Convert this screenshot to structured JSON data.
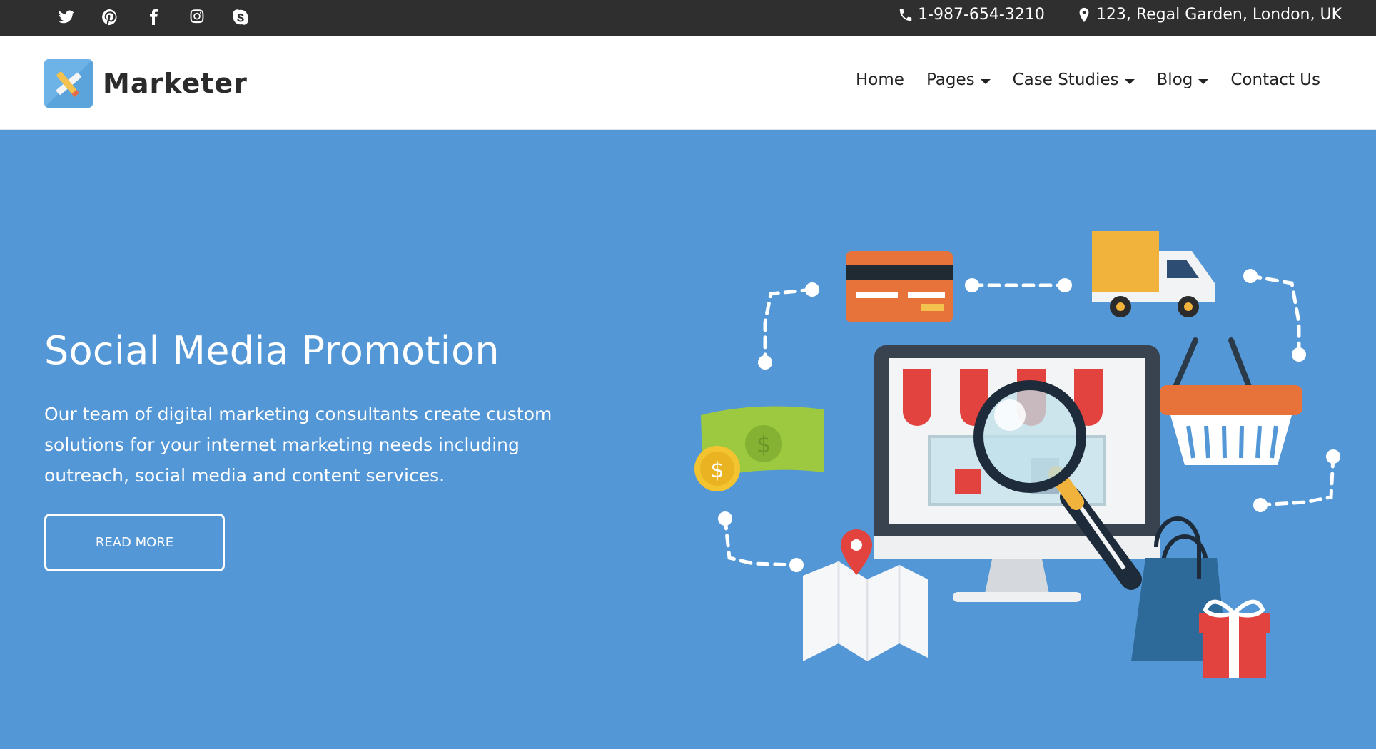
{
  "topbar": {
    "social_icons": [
      "twitter-icon",
      "pinterest-icon",
      "facebook-icon",
      "instagram-icon",
      "skype-icon"
    ],
    "phone": "1-987-654-3210",
    "address": "123, Regal Garden, London, UK"
  },
  "header": {
    "brand": "Marketer",
    "nav": {
      "home": "Home",
      "pages": "Pages",
      "case_studies": "Case Studies",
      "blog": "Blog",
      "contact": "Contact Us"
    }
  },
  "hero": {
    "title": "Social Media Promotion",
    "text": "Our team of digital marketing consultants create custom solutions for your internet marketing needs including outreach, social media and content services.",
    "button": "READ MORE"
  },
  "colors": {
    "topbar_bg": "#2f2f2f",
    "hero_bg": "#5497d6",
    "header_bg": "#ffffff"
  }
}
